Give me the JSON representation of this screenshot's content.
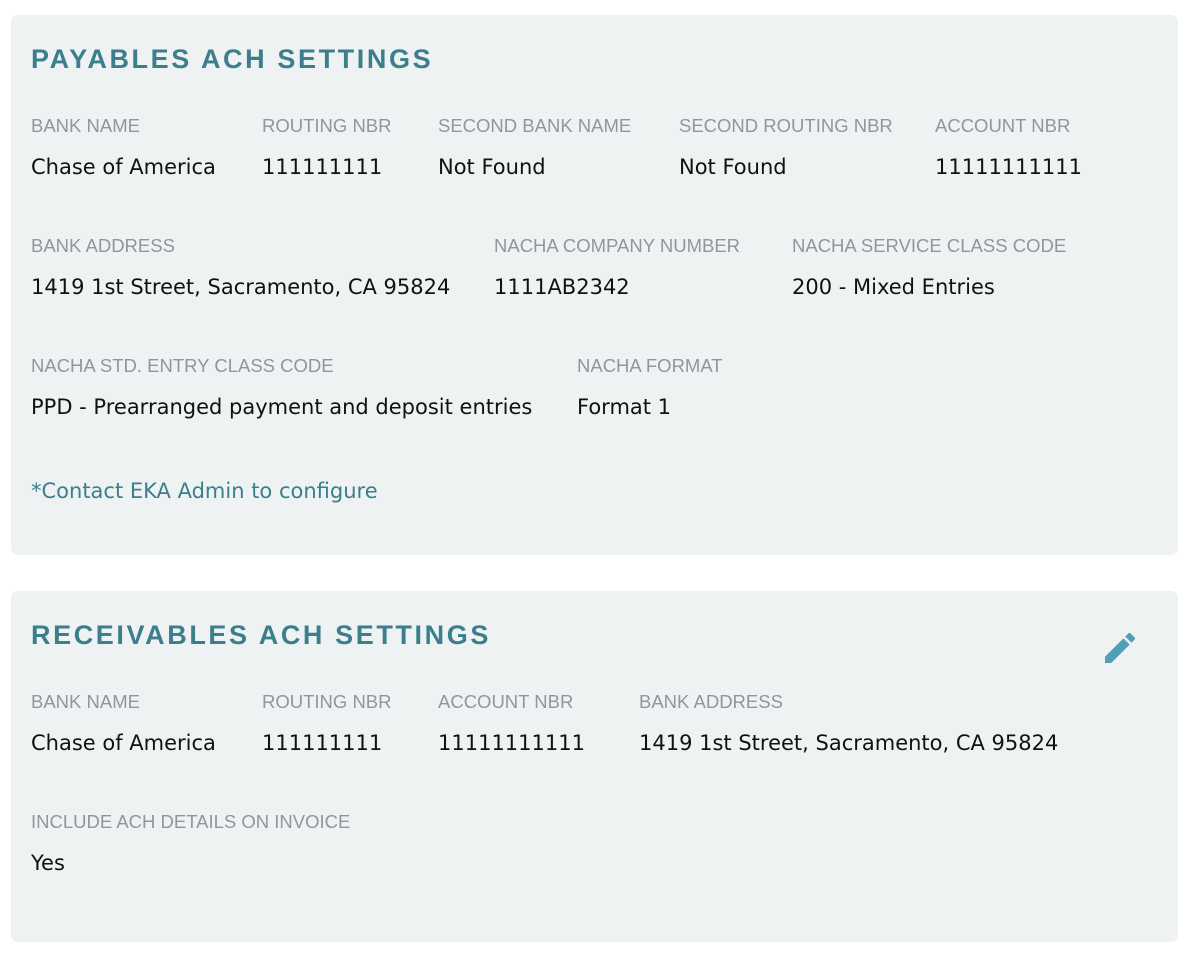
{
  "payables": {
    "title": "PAYABLES ACH SETTINGS",
    "bank_name": {
      "label": "BANK NAME",
      "value": "Chase of America"
    },
    "routing_nbr": {
      "label": "ROUTING NBR",
      "value": "111111111"
    },
    "second_bank_name": {
      "label": "SECOND BANK NAME",
      "value": "Not Found"
    },
    "second_routing_nbr": {
      "label": "SECOND ROUTING NBR",
      "value": "Not Found"
    },
    "account_nbr": {
      "label": "ACCOUNT NBR",
      "value": "11111111111"
    },
    "bank_address": {
      "label": "BANK ADDRESS",
      "value": "1419 1st Street, Sacramento, CA 95824"
    },
    "nacha_company_number": {
      "label": "NACHA COMPANY NUMBER",
      "value": "1111AB2342"
    },
    "nacha_service_class_code": {
      "label": "NACHA SERVICE CLASS CODE",
      "value": "200 - Mixed Entries"
    },
    "nacha_std_entry_class_code": {
      "label": "NACHA STD. ENTRY CLASS CODE",
      "value": "PPD - Prearranged payment and deposit entries"
    },
    "nacha_format": {
      "label": "NACHA FORMAT",
      "value": "Format 1"
    },
    "note": "*Contact EKA Admin to configure"
  },
  "receivables": {
    "title": "RECEIVABLES ACH SETTINGS",
    "edit_icon": "pencil-icon",
    "bank_name": {
      "label": "BANK NAME",
      "value": "Chase of America"
    },
    "routing_nbr": {
      "label": "ROUTING NBR",
      "value": "111111111"
    },
    "account_nbr": {
      "label": "ACCOUNT NBR",
      "value": "11111111111"
    },
    "bank_address": {
      "label": "BANK ADDRESS",
      "value": "1419 1st Street, Sacramento, CA 95824"
    },
    "include_ach_details": {
      "label": "INCLUDE ACH DETAILS ON INVOICE",
      "value": "Yes"
    }
  },
  "colors": {
    "card_background": "#eff2f3",
    "accent": "#3b7f8d",
    "label": "#8d979e",
    "value": "#111111",
    "edit_icon": "#4f9fb6"
  }
}
